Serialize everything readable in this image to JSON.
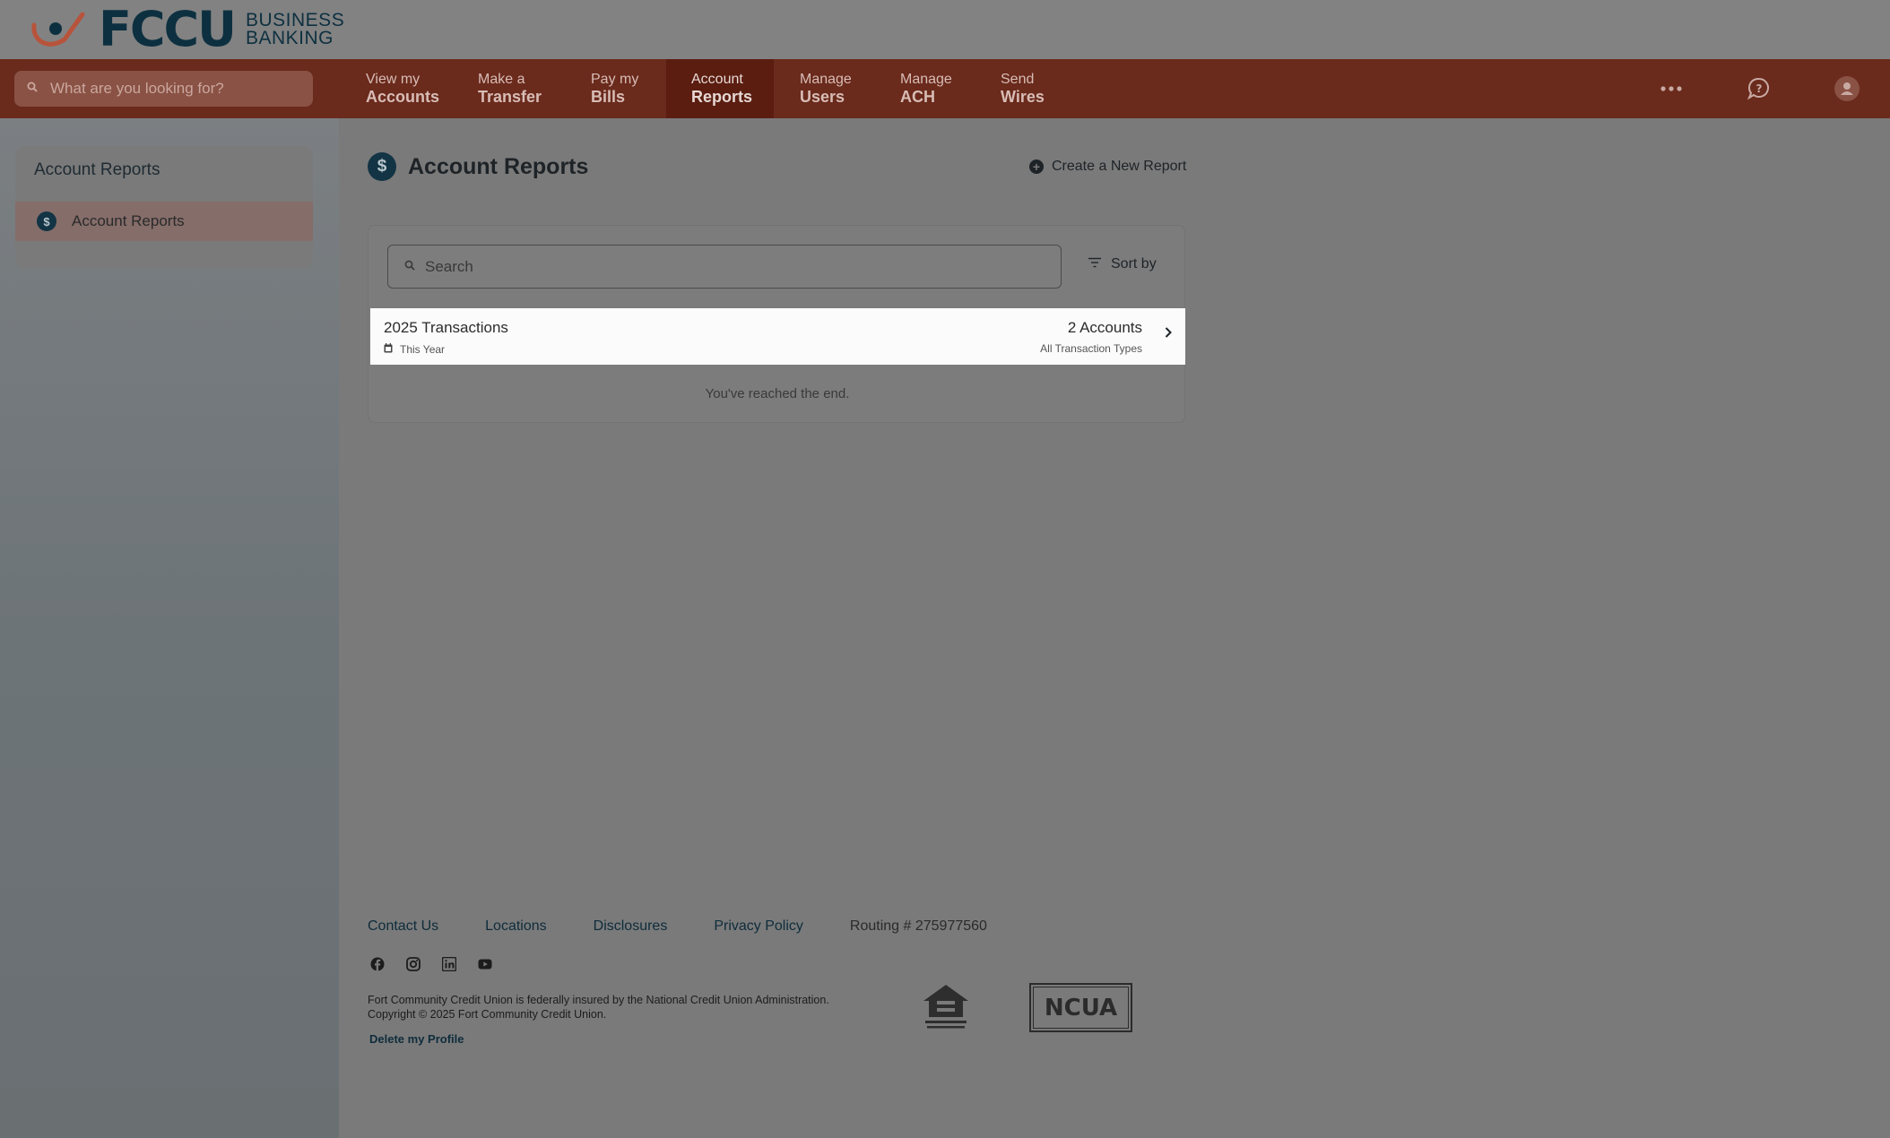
{
  "brand": {
    "logo_text": "FCCU",
    "sub_line1": "BUSINESS",
    "sub_line2": "BANKING",
    "colors": {
      "nav": "#6a2a1c",
      "nav_active": "#5a1d10",
      "accent": "#123444"
    }
  },
  "header": {
    "search_placeholder": "What are you looking for?",
    "nav": [
      {
        "l1": "View my",
        "l2": "Accounts"
      },
      {
        "l1": "Make a",
        "l2": "Transfer"
      },
      {
        "l1": "Pay my",
        "l2": "Bills"
      },
      {
        "l1": "Account",
        "l2": "Reports",
        "active": true
      },
      {
        "l1": "Manage",
        "l2": "Users"
      },
      {
        "l1": "Manage",
        "l2": "ACH"
      },
      {
        "l1": "Send",
        "l2": "Wires"
      }
    ],
    "icons": [
      "more-icon",
      "help-chat-icon",
      "user-avatar-icon"
    ]
  },
  "sidebar": {
    "title": "Account Reports",
    "items": [
      {
        "label": "Account Reports",
        "icon": "dollar-icon"
      }
    ]
  },
  "main": {
    "title": "Account Reports",
    "create_label": "Create a New Report",
    "search_placeholder": "Search",
    "sort_label": "Sort by",
    "reports": [
      {
        "title": "2025 Transactions",
        "period": "This Year",
        "accounts": "2 Accounts",
        "types": "All Transaction Types"
      }
    ],
    "end_text": "You've reached the end."
  },
  "footer": {
    "links": [
      "Contact Us",
      "Locations",
      "Disclosures",
      "Privacy Policy"
    ],
    "routing": "Routing # 275977560",
    "socials": [
      "facebook-icon",
      "instagram-icon",
      "linkedin-icon",
      "youtube-icon"
    ],
    "legal_line1": "Fort Community Credit Union is federally insured by the National Credit Union Administration.",
    "legal_line2": "Copyright © 2025 Fort Community Credit Union.",
    "delete_profile": "Delete my Profile",
    "ncua_text": "NCUA"
  }
}
